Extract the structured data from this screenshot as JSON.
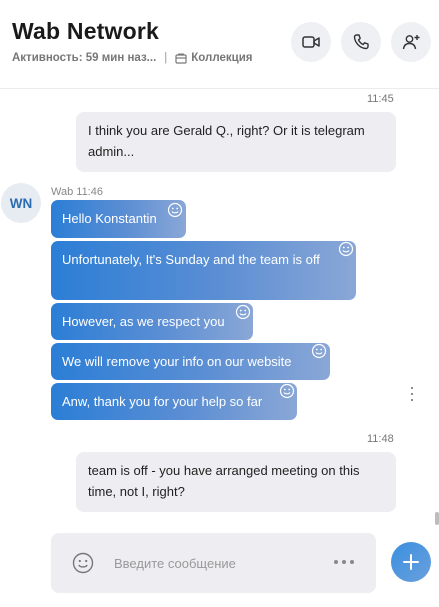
{
  "header": {
    "title": "Wab Network",
    "activity": "Активность: 59 мин наз...",
    "separator": "|",
    "collection": "Коллекция",
    "icons": [
      "video-icon",
      "phone-icon",
      "add-person-icon"
    ]
  },
  "messages": {
    "time_1": "11:45",
    "outgoing_1": "I think you are Gerald Q., right? Or it is telegram admin...",
    "avatar_initials": "WN",
    "sender_meta": "Wab 11:46",
    "incoming": [
      "Hello Konstantin",
      "Unfortunately, It's Sunday and the team is off",
      "However, as we respect you",
      "We will remove your info on our website",
      "Anw, thank you for your help so far"
    ],
    "time_2": "11:48",
    "outgoing_2": "team is off - you have arranged meeting on this time, not I, right?"
  },
  "composer": {
    "placeholder": "Введите сообщение"
  },
  "colors": {
    "accent": "#2b7ed6",
    "bubble_out": "#eeeef2"
  }
}
